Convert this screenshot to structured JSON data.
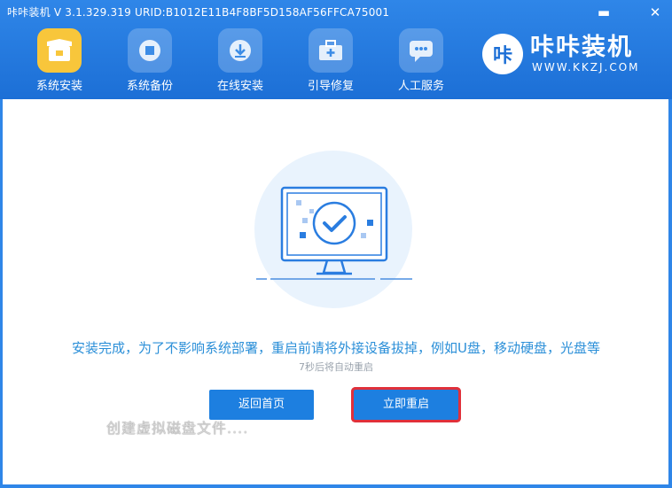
{
  "window": {
    "title": "咔咔装机 V 3.1.329.319 URID:B1012E11B4F8BF5D158AF56FFCA75001",
    "minimize_icon": "minimize-icon",
    "close_icon": "close-icon"
  },
  "nav": {
    "items": [
      {
        "label": "系统安装",
        "icon": "box-icon",
        "active": true
      },
      {
        "label": "系统备份",
        "icon": "backup-icon",
        "active": false
      },
      {
        "label": "在线安装",
        "icon": "download-icon",
        "active": false
      },
      {
        "label": "引导修复",
        "icon": "toolbox-icon",
        "active": false
      },
      {
        "label": "人工服务",
        "icon": "chat-icon",
        "active": false
      }
    ]
  },
  "brand": {
    "logo_char": "咔",
    "name": "咔咔装机",
    "url": "WWW.KKZJ.COM"
  },
  "main": {
    "message": "安装完成，为了不影响系统部署，重启前请将外接设备拔掉，例如U盘，移动硬盘，光盘等",
    "countdown": "7秒后将自动重启",
    "back_button": "返回首页",
    "restart_button": "立即重启",
    "overlay_text": "创建虚拟磁盘文件...."
  },
  "colors": {
    "primary": "#1c6fd6",
    "accent": "#f8c63b",
    "message": "#2b8fd8",
    "highlight": "#e0303a"
  }
}
